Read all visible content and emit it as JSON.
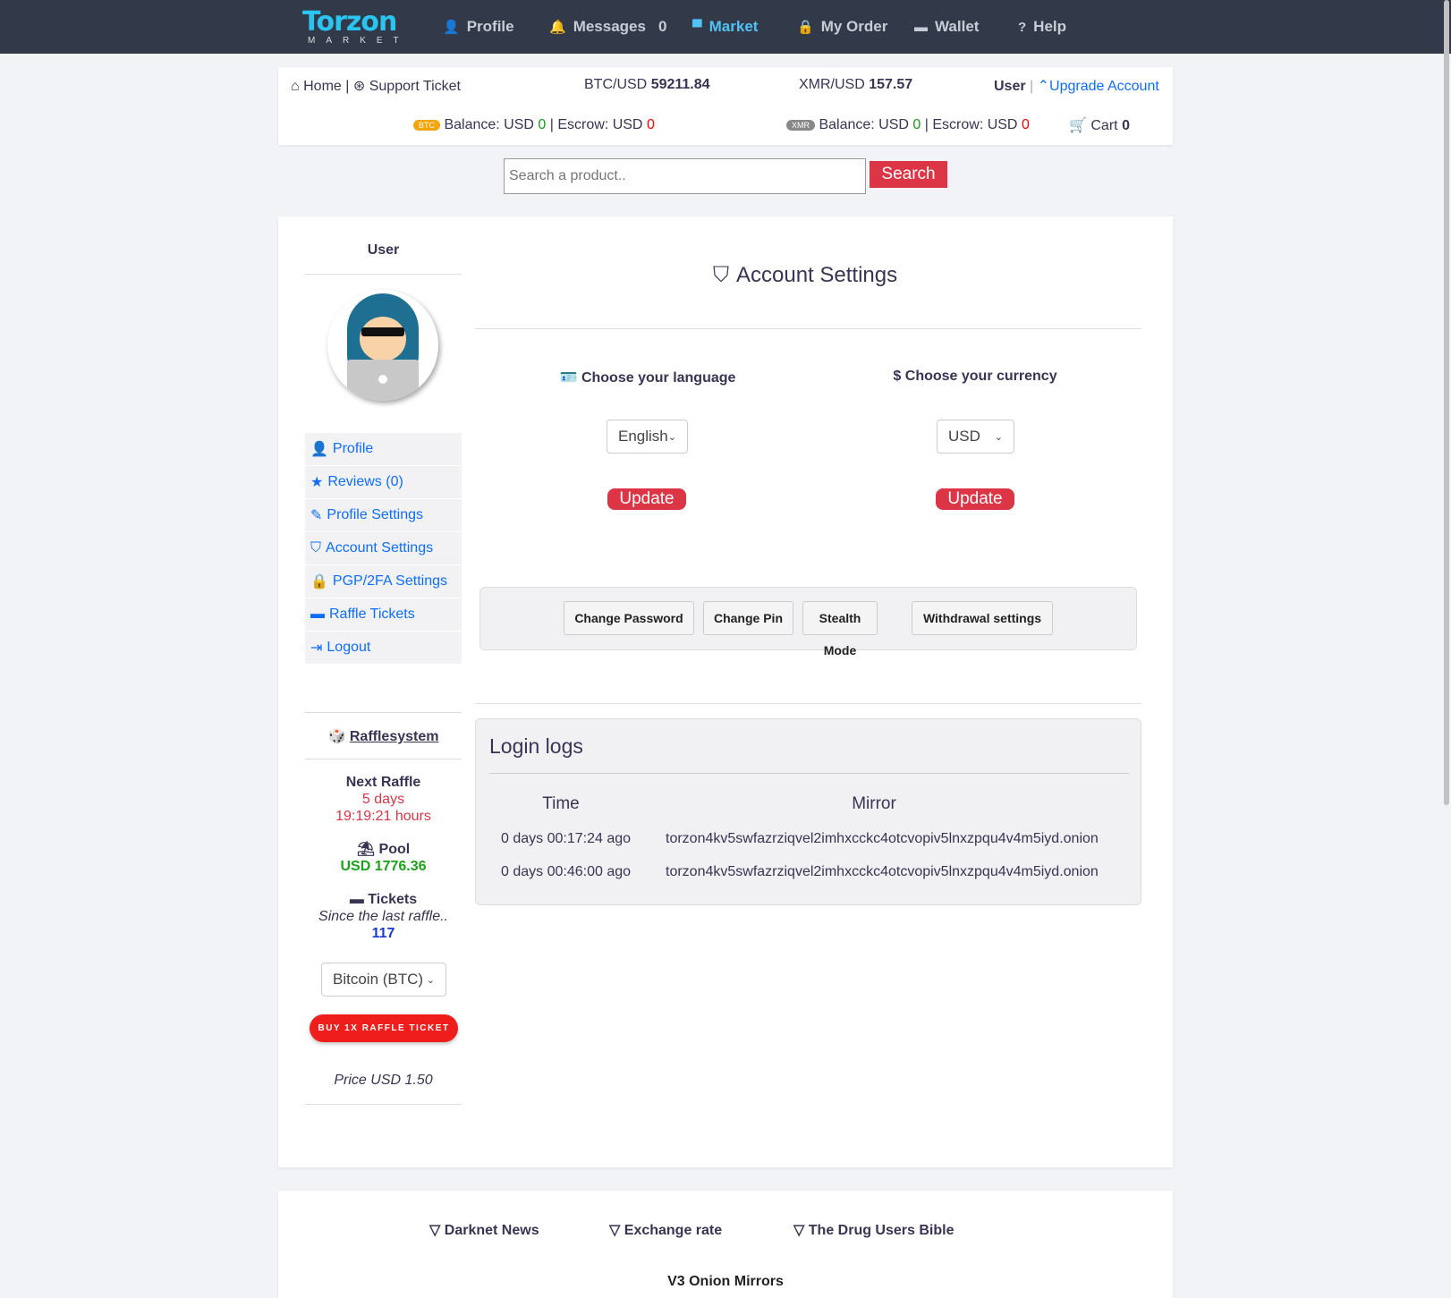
{
  "nav": {
    "logo_text": "Torzon",
    "logo_sub": "MARKET",
    "items": [
      {
        "label": "Profile",
        "icon": "user-icon"
      },
      {
        "label": "Messages",
        "count": "0",
        "icon": "bell-icon"
      },
      {
        "label": "Market",
        "icon": "store-icon",
        "active": true
      },
      {
        "label": "My Order",
        "icon": "bag-icon"
      },
      {
        "label": "Wallet",
        "icon": "wallet-icon"
      },
      {
        "label": "Help",
        "icon": "question-icon"
      }
    ]
  },
  "topbar": {
    "home": "Home",
    "support": "Support Ticket",
    "btc_label": "BTC/USD",
    "btc_rate": "59211.84",
    "xmr_label": "XMR/USD",
    "xmr_rate": "157.57",
    "user": "User",
    "upgrade": "Upgrade Account",
    "btc_badge": "BTC",
    "xmr_badge": "XMR",
    "balance_label": "Balance: USD",
    "escrow_label": "Escrow: USD",
    "btc_balance": "0",
    "btc_escrow": "0",
    "xmr_balance": "0",
    "xmr_escrow": "0",
    "cart_label": "Cart",
    "cart_count": "0"
  },
  "search": {
    "placeholder": "Search a product..",
    "button": "Search"
  },
  "sidebar": {
    "title": "User",
    "menu": [
      {
        "label": "Profile",
        "icon": "user-icon"
      },
      {
        "label": "Reviews (0)",
        "icon": "star-icon"
      },
      {
        "label": "Profile Settings",
        "icon": "pencil-icon"
      },
      {
        "label": "Account Settings",
        "icon": "shield-icon"
      },
      {
        "label": "PGP/2FA Settings",
        "icon": "lock-icon"
      },
      {
        "label": "Raffle Tickets",
        "icon": "ticket-icon"
      },
      {
        "label": "Logout",
        "icon": "logout-icon"
      }
    ],
    "raffle": {
      "title": "Rafflesystem",
      "next_label": "Next Raffle",
      "days": "5 days",
      "hours": "19:19:21 hours",
      "pool_label": "Pool",
      "pool_value": "USD 1776.36",
      "tickets_label": "Tickets",
      "since": "Since the last raffle..",
      "tickets_count": "117",
      "currency": "Bitcoin (BTC)",
      "buy": "BUY 1X RAFFLE TICKET",
      "price": "Price USD 1.50"
    }
  },
  "main": {
    "title": "Account Settings",
    "language_label": "Choose your language",
    "language_value": "English",
    "currency_label": "Choose your currency",
    "currency_value": "USD",
    "update": "Update",
    "buttons": [
      "Change Password",
      "Change Pin",
      "Stealth Mode",
      "Withdrawal settings"
    ],
    "logs": {
      "title": "Login logs",
      "headers": [
        "Time",
        "Mirror"
      ],
      "rows": [
        [
          "0 days 00:17:24 ago",
          "torzon4kv5swfazrziqvel2imhxcckc4otcvopiv5lnxzpqu4v4m5iyd.onion"
        ],
        [
          "0 days 00:46:00 ago",
          "torzon4kv5swfazrziqvel2imhxcckc4otcvopiv5lnxzpqu4v4m5iyd.onion"
        ]
      ]
    }
  },
  "footer": {
    "links": [
      "Darknet News",
      "Exchange rate",
      "The Drug Users Bible"
    ],
    "mirrors_title": "V3 Onion Mirrors"
  },
  "colors": {
    "navbar": "#323a49",
    "accent": "#4fc3f7",
    "link": "#0d6efd",
    "danger": "#dc3545"
  }
}
